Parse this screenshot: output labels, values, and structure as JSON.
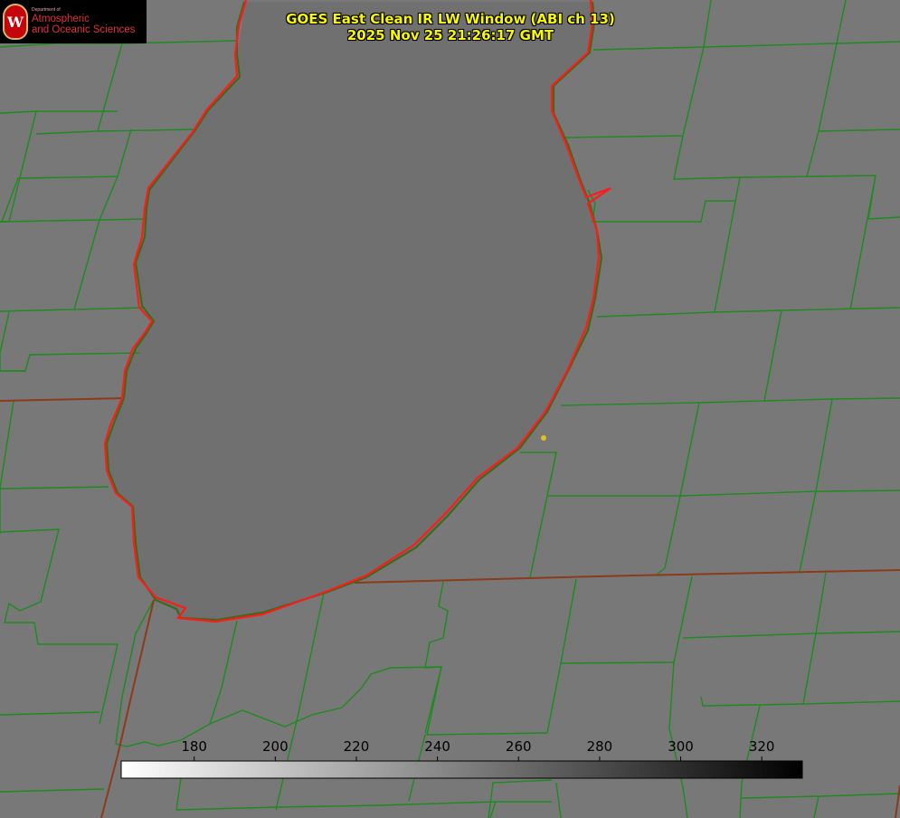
{
  "title": {
    "line1": "GOES East Clean IR LW Window (ABI ch 13)",
    "line2": "2025 Nov 25 21:26:17 GMT"
  },
  "logo": {
    "seal_letter": "W",
    "department": "Department of",
    "line1": "Atmospheric",
    "line2": "and Oceanic Sciences"
  },
  "colorbar": {
    "tick_labels": [
      "180",
      "200",
      "220",
      "240",
      "260",
      "280",
      "300",
      "320"
    ],
    "tick_values": [
      180,
      200,
      220,
      240,
      260,
      280,
      300,
      320
    ],
    "range": [
      162,
      330
    ],
    "gradient": "white (cold) to black (warm)"
  },
  "colors": {
    "background": "#787878",
    "lake": "#707070",
    "county_lines": "#1f8a1f",
    "state_lines": "#8b3a1a",
    "lake_outline": "#ff1a1a",
    "title_text": "#f8f800",
    "marker": "#e0c020"
  },
  "map_features": {
    "water_body": "lake",
    "boundaries": [
      "county",
      "state",
      "shoreline"
    ],
    "marker": "location-dot"
  }
}
